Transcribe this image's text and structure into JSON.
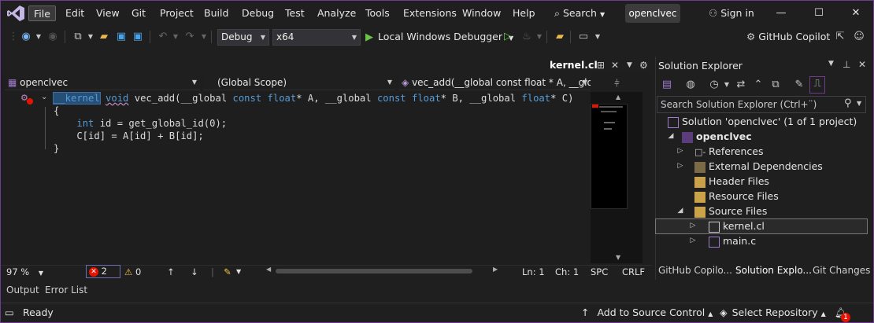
{
  "menu": {
    "items": [
      "File",
      "Edit",
      "View",
      "Git",
      "Project",
      "Build",
      "Debug",
      "Test",
      "Analyze",
      "Tools",
      "Extensions",
      "Window",
      "Help"
    ],
    "search_label": "Search",
    "solution_badge": "openclvec",
    "sign_in": "Sign in"
  },
  "toolbar": {
    "configuration": "Debug",
    "platform": "x64",
    "run_label": "Local Windows Debugger",
    "copilot_label": "GitHub Copilot"
  },
  "editor": {
    "tab_title": "kernel.cl",
    "nav_project": "openclvec",
    "nav_scope": "(Global Scope)",
    "nav_member": "vec_add(__global const float * A, __glob",
    "code": {
      "line1": {
        "kw_kernel": "__kernel",
        "sp1": " ",
        "kw_void": "void",
        "sp2": " ",
        "fn_name": "vec_add",
        "p1": "(__global ",
        "c1": "const",
        "sp3": " ",
        "t1": "float",
        "a1": "* A, __global ",
        "c2": "const",
        "sp4": " ",
        "t2": "float",
        "a2": "* B, __global ",
        "t3": "float",
        "a3": "* C)"
      },
      "line2": "{",
      "line3": {
        "indent": "    ",
        "kw_int": "int",
        "rest": " id = ",
        "fn": "get_global_id",
        "args": "(0);"
      },
      "line4": "    C[id] = A[id] + B[id];",
      "line5": "}"
    },
    "status": {
      "zoom": "97 %",
      "errors": "2",
      "warnings": "0",
      "line": "Ln: 1",
      "col": "Ch: 1",
      "spacing": "SPC",
      "eol": "CRLF"
    }
  },
  "solution_explorer": {
    "title": "Solution Explorer",
    "search_placeholder": "Search Solution Explorer (Ctrl+¨)",
    "solution": "Solution 'openclvec' (1 of 1 project)",
    "project": "openclvec",
    "references": "References",
    "external_deps": "External Dependencies",
    "header_files": "Header Files",
    "resource_files": "Resource Files",
    "source_files": "Source Files",
    "kernel_file": "kernel.cl",
    "main_file": "main.c",
    "tabs": [
      "GitHub Copilo...",
      "Solution Explo...",
      "Git Changes"
    ]
  },
  "bottom_tabs": [
    "Output",
    "Error List"
  ],
  "statusbar": {
    "ready": "Ready",
    "add_source_control": "Add to Source Control",
    "select_repository": "Select Repository",
    "notifications": "1"
  },
  "colors": {
    "accent": "#6e3b8f",
    "keyword": "#569cd6",
    "function": "#dcdcaa",
    "type": "#4ec9b0",
    "run_green": "#6cc24a",
    "error_red": "#e51400"
  }
}
